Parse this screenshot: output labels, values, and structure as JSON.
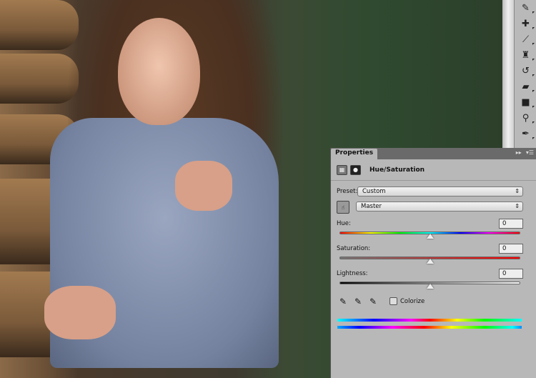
{
  "toolbar": {
    "tools": [
      {
        "name": "eyedropper-tool",
        "glyph": "✎"
      },
      {
        "name": "healing-brush-tool",
        "glyph": "✚"
      },
      {
        "name": "brush-tool",
        "glyph": "⟋"
      },
      {
        "name": "clone-stamp-tool",
        "glyph": "♜"
      },
      {
        "name": "history-brush-tool",
        "glyph": "↺"
      },
      {
        "name": "eraser-tool",
        "glyph": "▰"
      },
      {
        "name": "gradient-tool",
        "glyph": "■"
      },
      {
        "name": "dodge-tool",
        "glyph": "⚲"
      },
      {
        "name": "pen-tool",
        "glyph": "✒"
      }
    ]
  },
  "panel": {
    "tab": "Properties",
    "collapse_glyph": "▸▸",
    "menu_glyph": "▾☰",
    "title": "Hue/Saturation",
    "preset_label": "Preset:",
    "preset_value": "Custom",
    "channel_value": "Master",
    "hue_label": "Hue:",
    "hue_value": "0",
    "saturation_label": "Saturation:",
    "saturation_value": "0",
    "lightness_label": "Lightness:",
    "lightness_value": "0",
    "colorize_label": "Colorize",
    "colorize_checked": false,
    "hue_slider": 0.5,
    "saturation_slider": 0.5,
    "lightness_slider": 0.5
  }
}
